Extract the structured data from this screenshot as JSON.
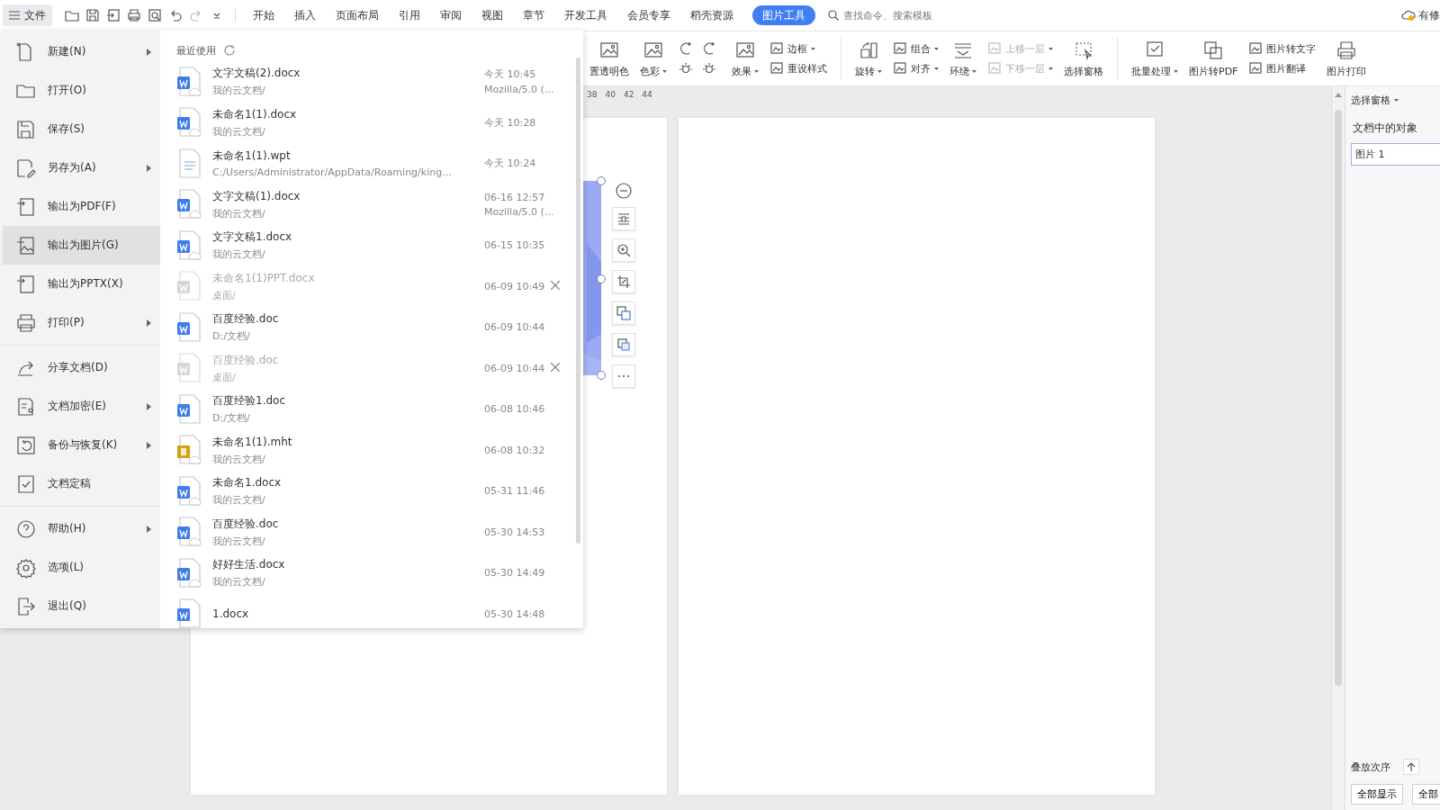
{
  "top_bar": {
    "file_button": "文件",
    "tabs": [
      {
        "label": "开始",
        "selected": false
      },
      {
        "label": "插入",
        "selected": false
      },
      {
        "label": "页面布局",
        "selected": false
      },
      {
        "label": "引用",
        "selected": false
      },
      {
        "label": "审阅",
        "selected": false
      },
      {
        "label": "视图",
        "selected": false
      },
      {
        "label": "章节",
        "selected": false
      },
      {
        "label": "开发工具",
        "selected": false
      },
      {
        "label": "会员专享",
        "selected": false
      },
      {
        "label": "稻壳资源",
        "selected": false
      },
      {
        "label": "图片工具",
        "selected": true
      }
    ],
    "search": {
      "placeholder": "查找命令、搜索模板"
    },
    "status": "有修"
  },
  "ribbon": {
    "columns": [
      {
        "kind": "large",
        "items": [
          {
            "label": "置透明色",
            "dropdown": false,
            "disabled": false
          }
        ]
      },
      {
        "kind": "large",
        "items": [
          {
            "label": "色彩",
            "dropdown": true,
            "disabled": false
          }
        ]
      },
      {
        "kind": "adjust"
      },
      {
        "kind": "large",
        "items": [
          {
            "label": "效果",
            "dropdown": true,
            "disabled": false
          }
        ]
      },
      {
        "kind": "stack",
        "items": [
          {
            "label": "边框",
            "dropdown": true,
            "disabled": false
          },
          {
            "label": "重设样式",
            "dropdown": false,
            "disabled": false
          }
        ]
      },
      {
        "kind": "separator"
      },
      {
        "kind": "large",
        "items": [
          {
            "label": "旋转",
            "dropdown": true,
            "disabled": false
          }
        ]
      },
      {
        "kind": "stack",
        "items": [
          {
            "label": "组合",
            "dropdown": true,
            "disabled": false
          },
          {
            "label": "对齐",
            "dropdown": true,
            "disabled": false
          }
        ]
      },
      {
        "kind": "large",
        "items": [
          {
            "label": "环绕",
            "dropdown": true,
            "disabled": false
          }
        ]
      },
      {
        "kind": "stack",
        "items": [
          {
            "label": "上移一层",
            "dropdown": true,
            "disabled": true
          },
          {
            "label": "下移一层",
            "dropdown": true,
            "disabled": true
          }
        ]
      },
      {
        "kind": "large",
        "items": [
          {
            "label": "选择窗格",
            "dropdown": false,
            "disabled": false
          }
        ]
      },
      {
        "kind": "separator"
      },
      {
        "kind": "large",
        "items": [
          {
            "label": "批量处理",
            "dropdown": true,
            "disabled": false
          }
        ]
      },
      {
        "kind": "large",
        "items": [
          {
            "label": "图片转PDF",
            "dropdown": false,
            "disabled": false
          }
        ]
      },
      {
        "kind": "stack",
        "items": [
          {
            "label": "图片转文字",
            "dropdown": false,
            "disabled": false
          },
          {
            "label": "图片翻译",
            "dropdown": false,
            "disabled": false
          }
        ]
      },
      {
        "kind": "large",
        "items": [
          {
            "label": "图片打印",
            "dropdown": false,
            "disabled": false
          }
        ]
      }
    ]
  },
  "ruler": {
    "ticks": [
      "38",
      "40",
      "42",
      "44"
    ]
  },
  "file_menu": {
    "groups": [
      [
        {
          "label": "新建(N)",
          "submenu": true,
          "selected": false
        },
        {
          "label": "打开(O)",
          "submenu": false,
          "selected": false
        },
        {
          "label": "保存(S)",
          "submenu": false,
          "selected": false
        },
        {
          "label": "另存为(A)",
          "submenu": true,
          "selected": false
        },
        {
          "label": "输出为PDF(F)",
          "submenu": false,
          "selected": false
        },
        {
          "label": "输出为图片(G)",
          "submenu": false,
          "selected": true
        },
        {
          "label": "输出为PPTX(X)",
          "submenu": false,
          "selected": false
        },
        {
          "label": "打印(P)",
          "submenu": true,
          "selected": false
        }
      ],
      [
        {
          "label": "分享文档(D)",
          "submenu": false,
          "selected": false
        },
        {
          "label": "文档加密(E)",
          "submenu": true,
          "selected": false
        },
        {
          "label": "备份与恢复(K)",
          "submenu": true,
          "selected": false
        },
        {
          "label": "文档定稿",
          "submenu": false,
          "selected": false
        }
      ],
      [
        {
          "label": "帮助(H)",
          "submenu": true,
          "selected": false
        },
        {
          "label": "选项(L)",
          "submenu": false,
          "selected": false
        },
        {
          "label": "退出(Q)",
          "submenu": false,
          "selected": false
        }
      ]
    ],
    "recent": {
      "title": "最近使用",
      "files": [
        {
          "name": "文字文稿(2).docx",
          "path": "我的云文档/",
          "time": "今天  10:45",
          "source": "Mozilla/5.0 (...",
          "kind": "word",
          "cloud": true,
          "disabled": false
        },
        {
          "name": "未命名1(1).docx",
          "path": "我的云文档/",
          "time": "今天  10:28",
          "kind": "word",
          "cloud": true,
          "disabled": false
        },
        {
          "name": "未命名1(1).wpt",
          "path": "C:/Users/Administrator/AppData/Roaming/king...",
          "time": "今天  10:24",
          "kind": "template",
          "cloud": false,
          "disabled": false
        },
        {
          "name": "文字文稿(1).docx",
          "path": "我的云文档/",
          "time": "06-16 12:57",
          "source": "Mozilla/5.0 (...",
          "kind": "word",
          "cloud": true,
          "disabled": false
        },
        {
          "name": "文字文稿1.docx",
          "path": "我的云文档/",
          "time": "06-15 10:35",
          "kind": "word",
          "cloud": true,
          "disabled": false
        },
        {
          "name": "未命名1(1)PPT.docx",
          "path": "桌面/",
          "time": "06-09 10:49",
          "kind": "word",
          "cloud": false,
          "disabled": true
        },
        {
          "name": "百度经验.doc",
          "path": "D:/文档/",
          "time": "06-09 10:44",
          "kind": "word",
          "cloud": false,
          "disabled": false
        },
        {
          "name": "百度经验.doc",
          "path": "桌面/",
          "time": "06-09 10:44",
          "kind": "word",
          "cloud": false,
          "disabled": true
        },
        {
          "name": "百度经验1.doc",
          "path": "D:/文档/",
          "time": "06-08 10:46",
          "kind": "word",
          "cloud": false,
          "disabled": false
        },
        {
          "name": "未命名1(1).mht",
          "path": "我的云文档/",
          "time": "06-08 10:32",
          "kind": "web",
          "cloud": true,
          "disabled": false
        },
        {
          "name": "未命名1.docx",
          "path": "我的云文档/",
          "time": "05-31 11:46",
          "kind": "word",
          "cloud": true,
          "disabled": false
        },
        {
          "name": "百度经验.doc",
          "path": "我的云文档/",
          "time": "05-30 14:53",
          "kind": "word",
          "cloud": true,
          "disabled": false
        },
        {
          "name": "好好生活.docx",
          "path": "我的云文档/",
          "time": "05-30 14:49",
          "kind": "word",
          "cloud": true,
          "disabled": false
        },
        {
          "name": "1.docx",
          "time": "05-30 14:48",
          "kind": "word",
          "disabled": false
        }
      ]
    }
  },
  "selection_pane": {
    "title": "选择窗格",
    "subtitle": "文档中的对象",
    "objects": [
      {
        "label": "图片 1",
        "selected": false
      }
    ],
    "order_label": "叠放次序",
    "buttons": [
      "全部显示",
      "全部"
    ]
  }
}
